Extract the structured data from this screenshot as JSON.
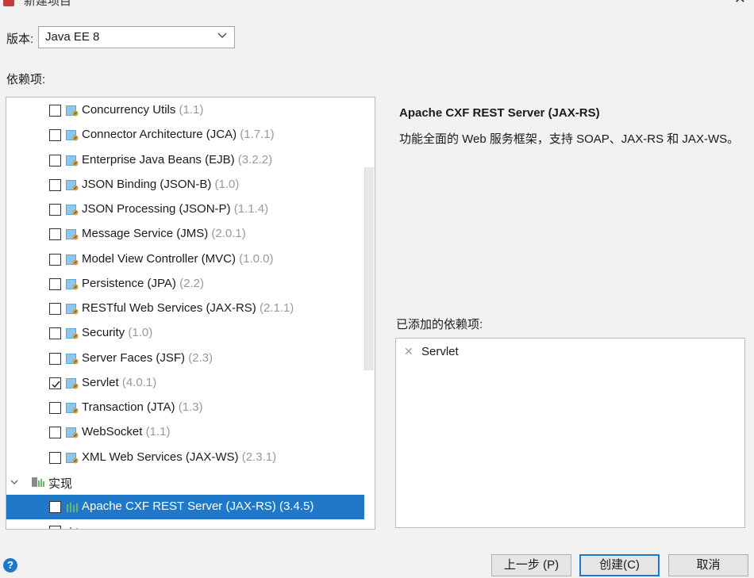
{
  "window": {
    "title": "新建项目",
    "app_icon": "app-icon",
    "close_icon": "close-icon"
  },
  "version": {
    "label": "版本:",
    "selected": "Java EE 8"
  },
  "deps_label": "依赖项:",
  "tree": {
    "items": [
      {
        "name": "Concurrency Utils",
        "version": "(1.1)",
        "checked": false
      },
      {
        "name": "Connector Architecture (JCA)",
        "version": "(1.7.1)",
        "checked": false
      },
      {
        "name": "Enterprise Java Beans (EJB)",
        "version": "(3.2.2)",
        "checked": false
      },
      {
        "name": "JSON Binding (JSON-B)",
        "version": "(1.0)",
        "checked": false
      },
      {
        "name": "JSON Processing (JSON-P)",
        "version": "(1.1.4)",
        "checked": false
      },
      {
        "name": "Message Service (JMS)",
        "version": "(2.0.1)",
        "checked": false
      },
      {
        "name": "Model View Controller (MVC)",
        "version": "(1.0.0)",
        "checked": false
      },
      {
        "name": "Persistence (JPA)",
        "version": "(2.2)",
        "checked": false
      },
      {
        "name": "RESTful Web Services (JAX-RS)",
        "version": "(2.1.1)",
        "checked": false
      },
      {
        "name": "Security",
        "version": "(1.0)",
        "checked": false
      },
      {
        "name": "Server Faces (JSF)",
        "version": "(2.3)",
        "checked": false
      },
      {
        "name": "Servlet",
        "version": "(4.0.1)",
        "checked": true
      },
      {
        "name": "Transaction (JTA)",
        "version": "(1.3)",
        "checked": false
      },
      {
        "name": "WebSocket",
        "version": "(1.1)",
        "checked": false
      },
      {
        "name": "XML Web Services (JAX-WS)",
        "version": "(2.3.1)",
        "checked": false
      }
    ],
    "category": {
      "name": "实现",
      "expanded": true
    },
    "impl_items": [
      {
        "name": "Apache CXF REST Server (JAX-RS)",
        "version": "(3.4.5)",
        "checked": false,
        "selected": true
      }
    ]
  },
  "description": {
    "title": "Apache CXF REST Server (JAX-RS)",
    "text": "功能全面的 Web 服务框架，支持 SOAP、JAX-RS 和 JAX-WS。"
  },
  "added": {
    "label": "已添加的依赖项:",
    "items": [
      "Servlet"
    ]
  },
  "help": "?",
  "buttons": {
    "prev": "上一步 (P)",
    "create": "创建(C)",
    "cancel": "取消"
  },
  "colors": {
    "accent": "#1f78c8",
    "version_text": "#999999"
  }
}
